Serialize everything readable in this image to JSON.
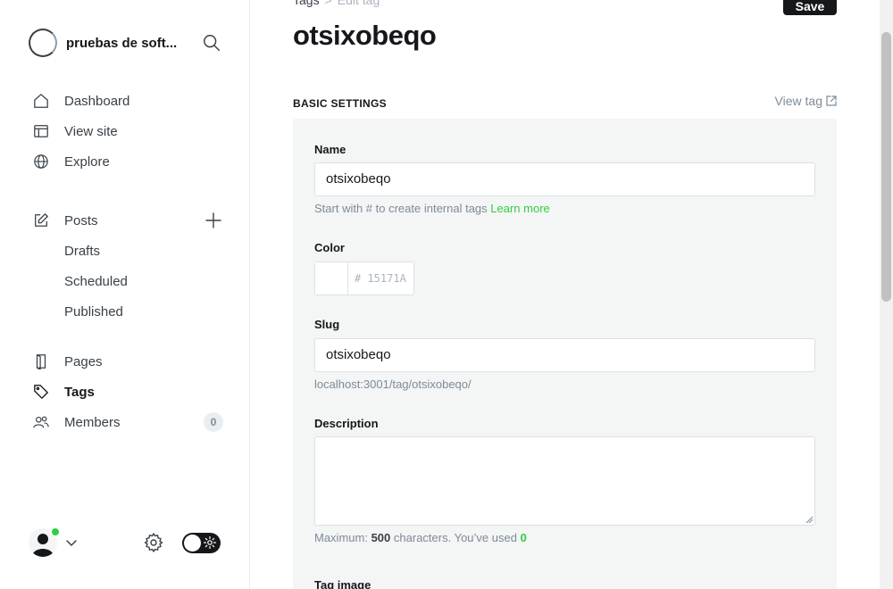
{
  "sidebar": {
    "brand_name": "pruebas de soft...",
    "nav_primary": [
      {
        "label": "Dashboard",
        "icon": "home-icon"
      },
      {
        "label": "View site",
        "icon": "view-site-icon"
      },
      {
        "label": "Explore",
        "icon": "globe-icon"
      }
    ],
    "posts": {
      "label": "Posts",
      "subitems": [
        "Drafts",
        "Scheduled",
        "Published"
      ]
    },
    "nav_secondary": [
      {
        "label": "Pages",
        "icon": "pages-icon"
      },
      {
        "label": "Tags",
        "icon": "tag-icon",
        "active": true
      },
      {
        "label": "Members",
        "icon": "members-icon",
        "count": "0"
      }
    ]
  },
  "header": {
    "breadcrumb_parent": "Tags",
    "breadcrumb_separator": ">",
    "breadcrumb_current": "Edit tag",
    "save_label": "Save",
    "title": "otsixobeqo"
  },
  "section": {
    "title": "BASIC SETTINGS",
    "view_link": "View tag"
  },
  "form": {
    "name_label": "Name",
    "name_value": "otsixobeqo",
    "name_hint": "Start with # to create internal tags",
    "name_hint_link": "Learn more",
    "color_label": "Color",
    "color_placeholder": "# 15171A",
    "slug_label": "Slug",
    "slug_value": "otsixobeqo",
    "slug_url": "localhost:3001/tag/otsixobeqo/",
    "description_label": "Description",
    "description_value": "",
    "desc_hint_prefix": "Maximum:",
    "desc_max": "500",
    "desc_hint_mid": "characters. You’ve used",
    "desc_used": "0",
    "tag_image_label": "Tag image"
  },
  "colors": {
    "accent": "#30cf43",
    "dark": "#15171a",
    "panel_bg": "#f4f5f5"
  }
}
